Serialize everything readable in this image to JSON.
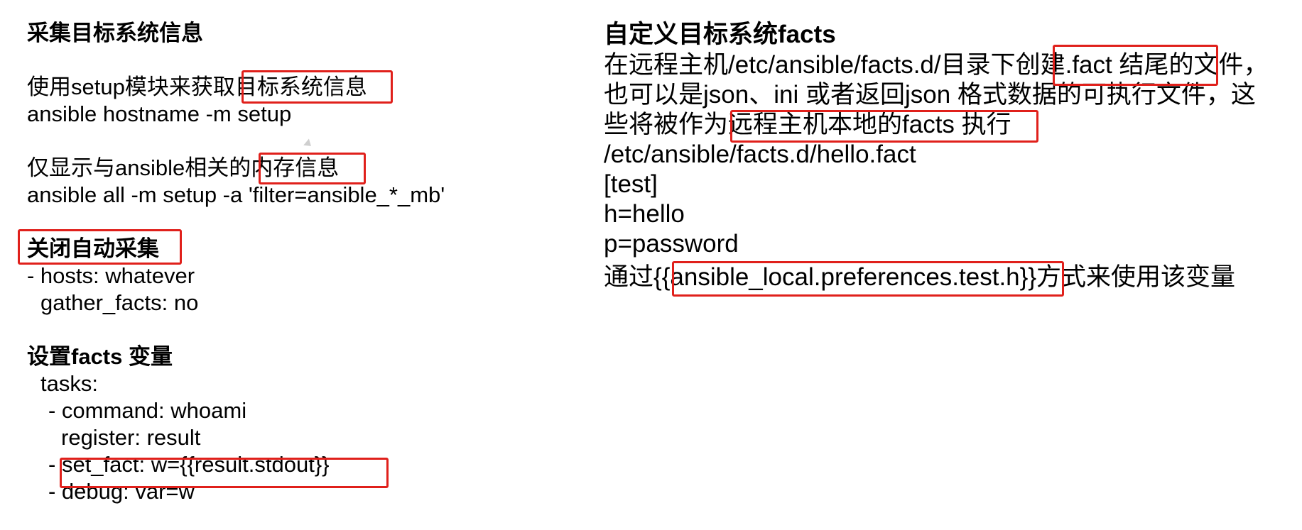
{
  "left": {
    "gather_heading": "采集目标系统信息",
    "setup_line_prefix": "使用setup模块来获取",
    "setup_line_highlight": "目标系统信息",
    "setup_cmd": "ansible hostname -m setup",
    "mem_line_prefix": "仅显示与ansible相关的",
    "mem_line_highlight": "内存信息",
    "mem_cmd": "ansible all -m setup -a 'filter=ansible_*_mb'",
    "disable_heading": "关闭自动采集",
    "hosts_line": "- hosts: whatever",
    "gather_facts_line": "gather_facts: no",
    "set_facts_heading": "设置facts 变量",
    "tasks_line": "tasks:",
    "command_line": "- command: whoami",
    "register_line": "register: result",
    "set_fact_dash": "-",
    "set_fact_line": "set_fact: w={{result.stdout}}",
    "debug_line": "- debug: var=w"
  },
  "right": {
    "custom_heading": "自定义目标系统facts",
    "line1_prefix": "在远程主机/etc/ansible/facts.d/目录下",
    "line1_highlight": "创建.fact 结尾",
    "line1_suffix": "的文件，",
    "line2": "也可以是json、ini 或者返回json 格式数据的可执行文件，这",
    "line3_prefix": "些将被作为",
    "line3_highlight": "远程主机本地的facts 执行",
    "path_line": "/etc/ansible/facts.d/hello.fact",
    "section_line": "[test]",
    "h_line": "h=hello",
    "p_line": "p=password",
    "usage_prefix": "通过{{",
    "usage_highlight": "ansible_local.preferences.test.h",
    "usage_suffix": "}}方式来使用该变量"
  }
}
